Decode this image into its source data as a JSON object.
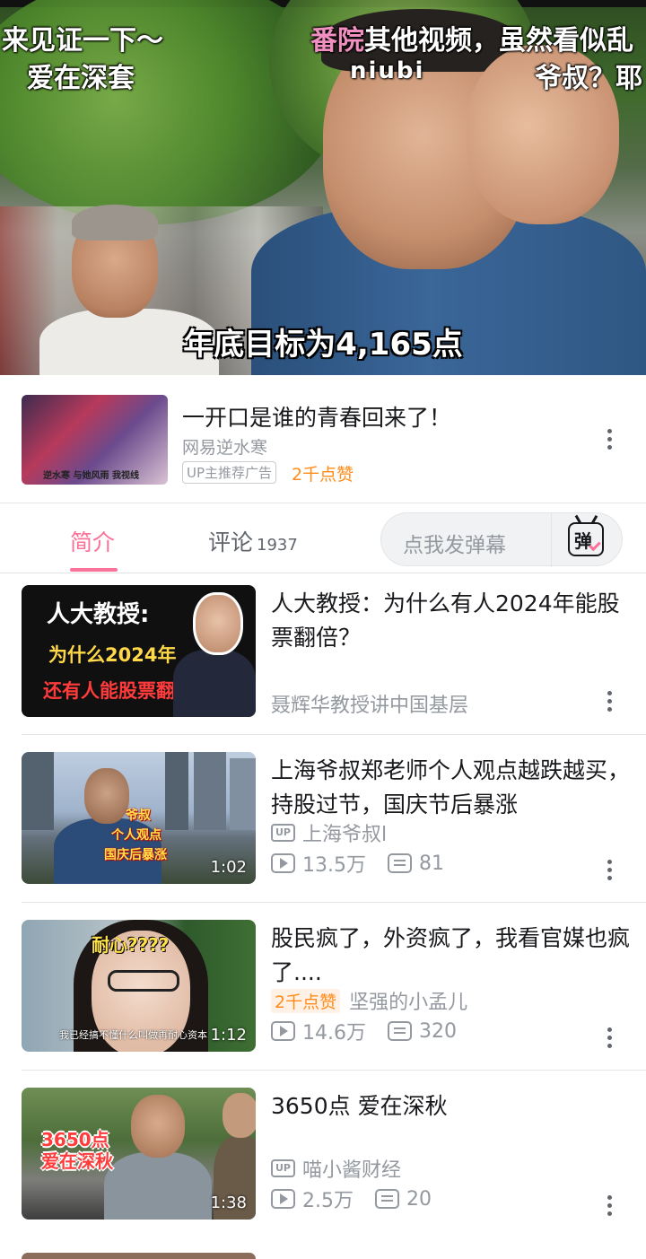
{
  "player": {
    "danmaku": [
      {
        "text": "来见证一下～"
      },
      {
        "text": "爱在深套"
      },
      {
        "text_pink": "番院",
        "text": "其他视频，虽然看似乱"
      },
      {
        "text": "niubi"
      },
      {
        "text": "爷叔？耶"
      }
    ],
    "subtitle": "年底目标为4,165点"
  },
  "ad": {
    "title": "一开口是谁的青春回来了！",
    "author": "网易逆水寒",
    "badge": "UP主推荐广告",
    "likes": "2千点赞",
    "thumb_text": "逆水寒 与她风雨 我视线"
  },
  "tabs": {
    "intro": "简介",
    "comments": "评论",
    "comments_count": "1937",
    "danmaku_placeholder": "点我发弹幕",
    "danmaku_icon_char": "弹"
  },
  "recommendations": [
    {
      "title": "人大教授：为什么有人2024年能股票翻倍？",
      "author": "聂辉华教授讲中国基层",
      "thumb": {
        "line1": "人大教授:",
        "line2": "为什么2024年",
        "line3": "还有人能股票翻倍"
      }
    },
    {
      "title": "上海爷叔郑老师个人观点越跌越买，持股过节，国庆节后暴涨",
      "author": "上海爷叔l",
      "views": "13.5万",
      "danmaku": "81",
      "duration": "1:02",
      "thumb": {
        "cap1": "爷叔",
        "cap2": "个人观点",
        "cap3": "国庆后暴涨"
      }
    },
    {
      "title": "股民疯了，外资疯了，我看官媒也疯了....",
      "like_badge": "2千点赞",
      "author": "坚强的小孟儿",
      "views": "14.6万",
      "danmaku": "320",
      "duration": "1:12",
      "thumb": {
        "cap1": "耐心????",
        "cap2": "我已经搞不懂什么叫做再耐心资本"
      }
    },
    {
      "title": "3650点 爱在深秋",
      "author": "喵小酱财经",
      "views": "2.5万",
      "danmaku": "20",
      "duration": "1:38",
      "thumb": {
        "cap1": "3650点",
        "cap2": "爱在深秋"
      }
    }
  ],
  "icons": {
    "more": "more-vertical-icon",
    "up": "up-badge-icon",
    "play": "play-count-icon",
    "danmaku_count": "danmaku-count-icon"
  },
  "colors": {
    "accent": "#fb7299",
    "orange": "#ff8c1a",
    "muted": "#9499a0"
  }
}
